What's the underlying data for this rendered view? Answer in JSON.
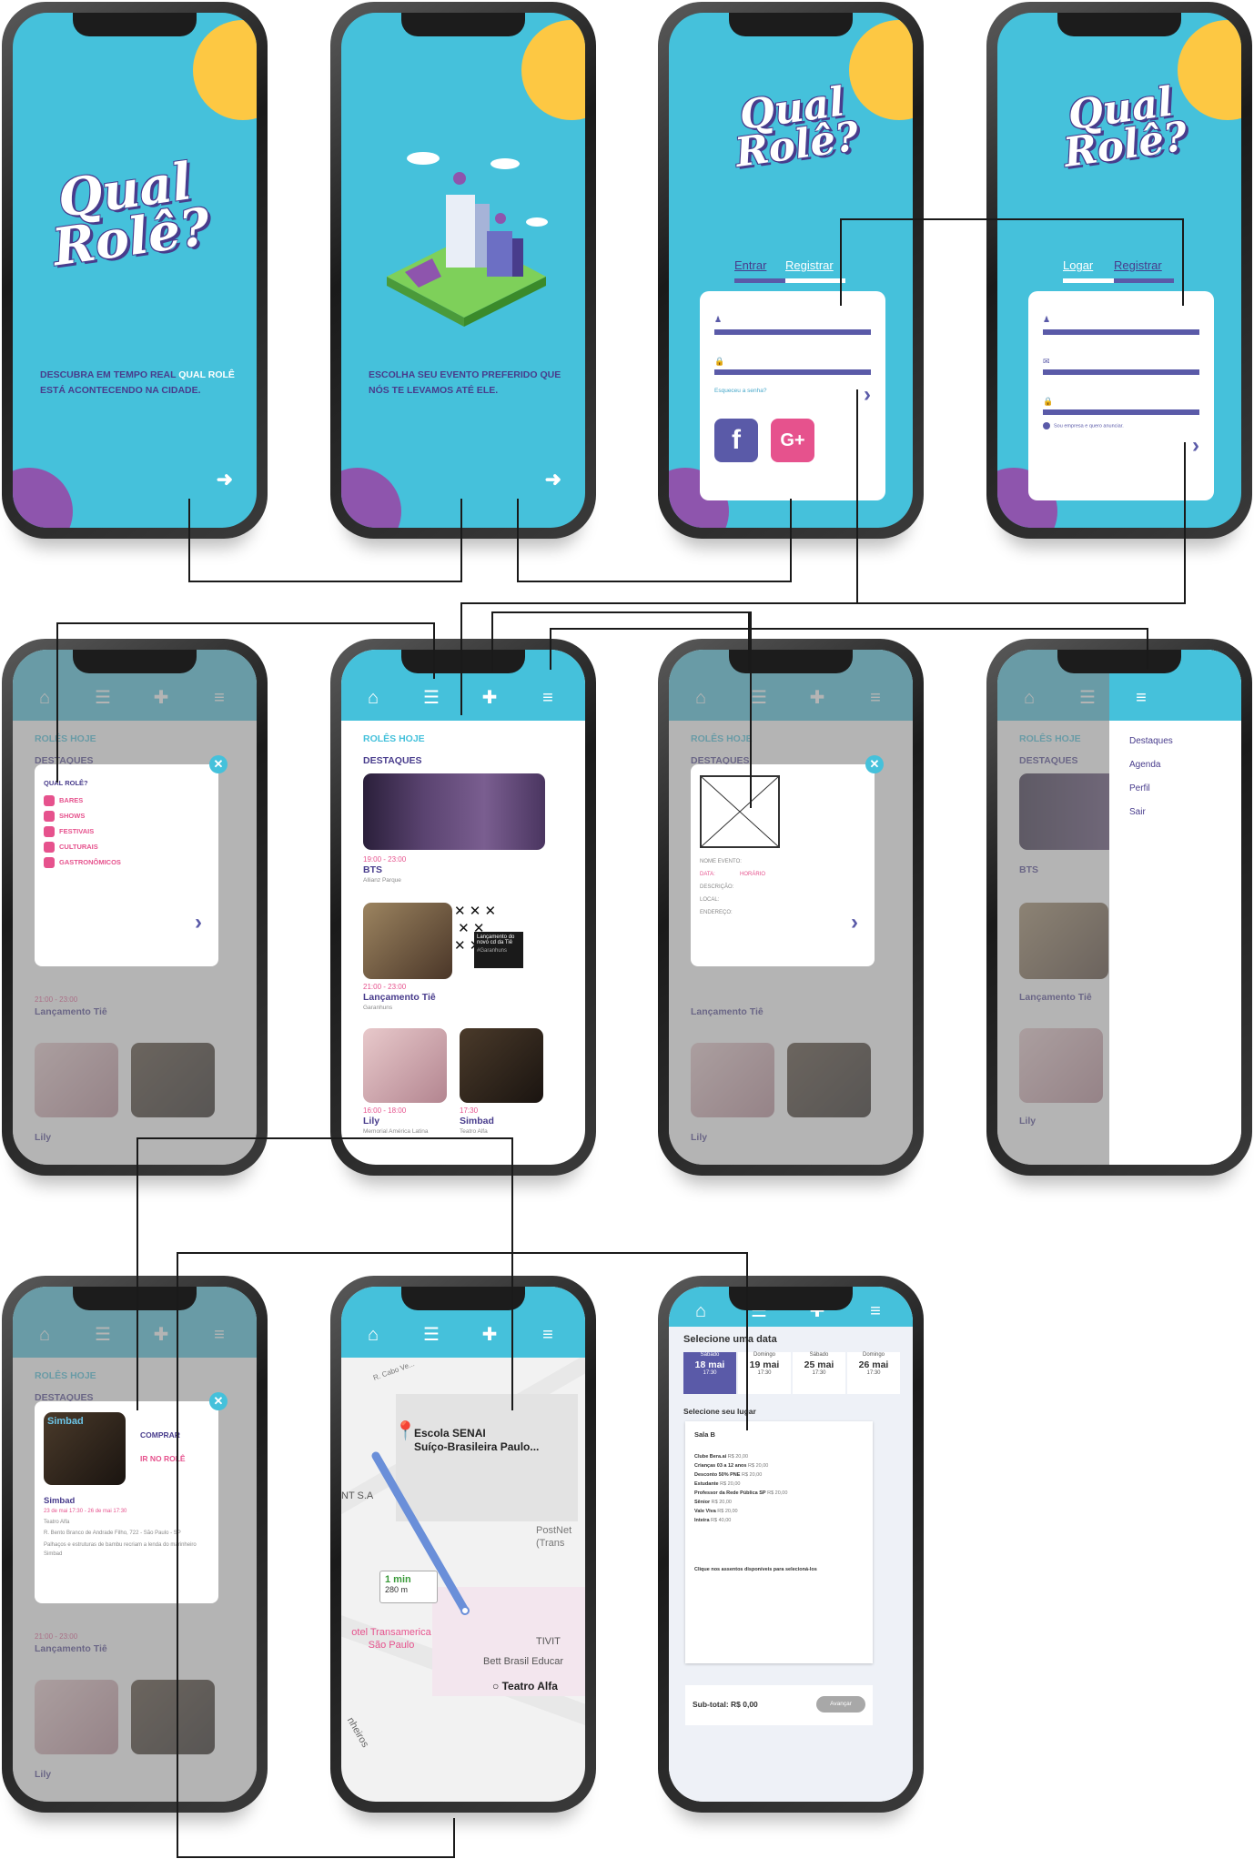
{
  "splash": {
    "tagline_a": "DESCUBRA EM TEMPO REAL ",
    "tagline_hl": "QUAL ROLÊ",
    "tagline_b": "ESTÁ ACONTECENDO NA CIDADE.",
    "logo_line1": "Qual",
    "logo_line2": "Rolê?"
  },
  "onboarding": {
    "tagline": "ESCOLHA SEU EVENTO PREFERIDO QUE NÓS TE LEVAMOS ATÉ ELE."
  },
  "login": {
    "tab_enter": "Entrar",
    "tab_register": "Registrar",
    "forgot": "Esqueceu a senha?",
    "facebook": "f",
    "google": "G+"
  },
  "register": {
    "tab_login": "Logar",
    "tab_register": "Registrar",
    "check_label": "Sou empresa e quero anunciar."
  },
  "feed": {
    "section_today": "ROLÊS HOJE",
    "section_highlights": "DESTAQUES",
    "events": [
      {
        "time": "19:00 - 23:00",
        "title": "BTS",
        "place": "Allianz Parque"
      },
      {
        "time": "21:00 - 23:00",
        "title": "Lançamento Tiê",
        "place": "Garanhuns"
      },
      {
        "time": "16:00 - 18:00",
        "title": "Lily",
        "place": "Memorial América Latina"
      },
      {
        "time": "17:30",
        "title": "Simbad",
        "place": "Teatro Alfa"
      }
    ],
    "overlay_caption": "Lançamento do novo cd da Tiê",
    "overlay_tag": "#Garanhuns"
  },
  "filter": {
    "title": "QUAL ROLÊ?",
    "items": [
      "BARES",
      "SHOWS",
      "FESTIVAIS",
      "CULTURAIS",
      "GASTRONÔMICOS"
    ]
  },
  "event_form": {
    "name": "NOME EVENTO:",
    "date": "DATA:",
    "hour": "HORÁRIO",
    "desc": "DESCRIÇÃO:",
    "local": "LOCAL:",
    "address": "ENDEREÇO:"
  },
  "menu": {
    "items": [
      "Destaques",
      "Agenda",
      "Perfil",
      "Sair"
    ]
  },
  "detail": {
    "buy": "COMPRAR",
    "go": "IR NO ROLÊ",
    "title": "Simbad",
    "dates": "23 de mai 17:30 - 26 de mai 17:30",
    "venue": "Teatro Alfa",
    "address": "R. Bento Branco de Andrade Filho, 722 - São Paulo - SP",
    "desc": "Palhaços e estruturas de bambu recriam a lenda do marinheiro Simbad",
    "image_label": "Simbad"
  },
  "map": {
    "street": "R. Cabo Ve...",
    "school_a": "Escola SENAI",
    "school_b": "Suíço-Brasileira Paulo...",
    "route_time": "1 min",
    "route_dist": "280 m",
    "hotel_a": "otel Transamerica",
    "hotel_b": "São Paulo",
    "postnet_a": "PostNet",
    "postnet_b": "(Trans",
    "tivit": "TIVIT",
    "bett": "Bett Brasil Educar",
    "theater": "Teatro Alfa",
    "nt": "NT S.A",
    "pinheiros": "nheiros"
  },
  "booking": {
    "select_date": "Selecione uma data",
    "dates": [
      {
        "day": "Sábado",
        "date": "18 mai",
        "time": "17:30"
      },
      {
        "day": "Domingo",
        "date": "19 mai",
        "time": "17:30"
      },
      {
        "day": "Sábado",
        "date": "25 mai",
        "time": "17:30"
      },
      {
        "day": "Domingo",
        "date": "26 mai",
        "time": "17:30"
      }
    ],
    "select_seat": "Selecione seu lugar",
    "room": "Sala B",
    "prices": [
      {
        "name": "Clube Bera.ai",
        "price": "R$ 20,00"
      },
      {
        "name": "Crianças 03 a 12 anos",
        "price": "R$ 20,00"
      },
      {
        "name": "Desconto 50% PNE",
        "price": "R$ 20,00"
      },
      {
        "name": "Estudante",
        "price": "R$ 20,00"
      },
      {
        "name": "Professor da Rede Pública SP",
        "price": "R$ 20,00"
      },
      {
        "name": "Sênior",
        "price": "R$ 20,00"
      },
      {
        "name": "Vale Viva",
        "price": "R$ 20,00"
      },
      {
        "name": "Inteira",
        "price": "R$ 40,00"
      }
    ],
    "hint": "Clique nos assentos disponíveis para selecioná-los",
    "subtotal": "Sub-total: R$ 0,00",
    "advance": "Avançar"
  },
  "colors": {
    "teal": "#45c1db",
    "purple": "#483c8c",
    "pink": "#e6528d",
    "yellow": "#fdc843",
    "violet": "#8e55ad"
  }
}
